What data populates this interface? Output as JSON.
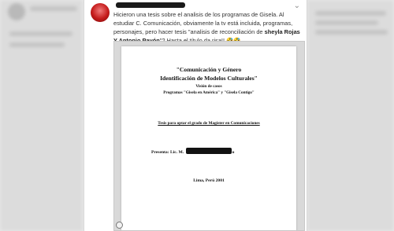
{
  "tweet": {
    "text_part1": "Hicieron una tesis sobre el analisis de los programas de Gisela. Al estudiar C. Comunicación, obviamente la tv está incluida, programas, personajes, pero hacer tesis \"analisis de reconciliación de ",
    "text_bold": "sheyla Rojas Y Antonio Pavón",
    "text_part2": "\"? Hasta el título da risa!! 🤣🤣"
  },
  "document": {
    "title_line1": "\"Comunicación y Género",
    "title_line2": "Identificación de Modelos Culturales\"",
    "subtitle1": "Visión de casos",
    "subtitle2": "Programas \"Gisela en América\" y \"Gisela Contigo\"",
    "thesis_line": "Tesis para optar el grado de Magíster en Comunicaciones",
    "presenter_prefix": "Presenta:  Lic. M.",
    "presenter_suffix": "o",
    "place_date": "Lima, Perú 2001"
  }
}
